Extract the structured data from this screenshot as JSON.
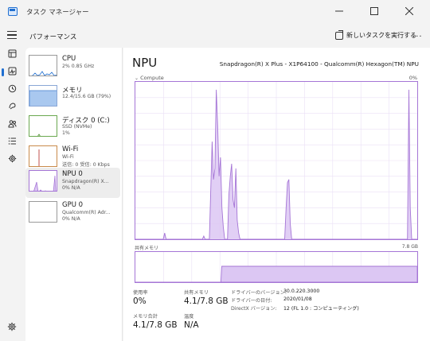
{
  "window": {
    "title": "タスク マネージャー",
    "minimize_icon": "minimize-icon",
    "maximize_icon": "maximize-icon",
    "close_icon": "close-icon"
  },
  "header": {
    "page_title": "パフォーマンス",
    "new_task_label": "新しいタスクを実行する",
    "more_label": "..."
  },
  "nav": [
    {
      "name": "processes",
      "icon": "processes-icon"
    },
    {
      "name": "performance",
      "icon": "performance-icon",
      "active": true
    },
    {
      "name": "app-history",
      "icon": "history-icon"
    },
    {
      "name": "startup-apps",
      "icon": "startup-icon"
    },
    {
      "name": "users",
      "icon": "users-icon"
    },
    {
      "name": "details",
      "icon": "details-icon"
    },
    {
      "name": "services",
      "icon": "services-icon"
    },
    {
      "name": "settings",
      "icon": "gear-icon"
    }
  ],
  "resources": [
    {
      "name": "CPU",
      "line1": "2% 0.85 GHz",
      "line2": ""
    },
    {
      "name": "メモリ",
      "line1": "12.4/15.6 GB (79%)",
      "line2": ""
    },
    {
      "name": "ディスク 0 (C:)",
      "line1": "SSD (NVMe)",
      "line2": "1%"
    },
    {
      "name": "Wi-Fi",
      "line1": "Wi-Fi",
      "line2": "送信: 0 受信: 0 Kbps"
    },
    {
      "name": "NPU 0",
      "line1": "Snapdragon(R) X...",
      "line2": "0% N/A"
    },
    {
      "name": "GPU 0",
      "line1": "Qualcomm(R) Adr...",
      "line2": "0% N/A"
    }
  ],
  "detail": {
    "title": "NPU",
    "model": "Snapdragon(R) X Plus - X1P64100 - Qualcomm(R) Hexagon(TM) NPU",
    "graph_label": "Compute",
    "graph_pct": "0%",
    "mem_label": "共有メモリ",
    "mem_max": "7.8 GB",
    "stats": {
      "usage_label": "使用率",
      "usage_value": "0%",
      "shared_label": "共有メモリ",
      "shared_value": "4.1/7.8 GB",
      "memtotal_label": "メモリ合計",
      "memtotal_value": "4.1/7.8 GB",
      "temp_label": "温度",
      "temp_value": "N/A"
    },
    "info": [
      {
        "label": "ドライバーのバージョン:",
        "value": "30.0.220.3000"
      },
      {
        "label": "ドライバーの日付:",
        "value": "2020/01/08"
      },
      {
        "label": "DirectX バージョン:",
        "value": "12 (FL 1.0 : コンピューティング)"
      }
    ]
  },
  "colors": {
    "accent": "#1f6fd1",
    "npu_line": "#a575d6",
    "npu_fill": "#dcc7f3"
  },
  "npu_graph": {
    "usage_percent": [
      0,
      0,
      0,
      0,
      0,
      0,
      0,
      0,
      0,
      0,
      0,
      0,
      0,
      0,
      0,
      0,
      0,
      0,
      0,
      0,
      0,
      4,
      0,
      0,
      0,
      0,
      0,
      0,
      0,
      0,
      0,
      0,
      0,
      0,
      0,
      0,
      0,
      0,
      0,
      0,
      0,
      0,
      0,
      0,
      0,
      0,
      0,
      0,
      0,
      2,
      0,
      0,
      0,
      0,
      30,
      62,
      38,
      45,
      95,
      72,
      40,
      52,
      20,
      8,
      0,
      0,
      0,
      28,
      40,
      48,
      25,
      20,
      45,
      12,
      4,
      0,
      0,
      0,
      0,
      0,
      0,
      0,
      0,
      0,
      0,
      0,
      0,
      0,
      0,
      0,
      0,
      0,
      0,
      0,
      0,
      0,
      0,
      0,
      0,
      0,
      0,
      0,
      0,
      0,
      0,
      0,
      0,
      0,
      20,
      36,
      38,
      10,
      0,
      0,
      0,
      0,
      0,
      0,
      0,
      0,
      0,
      0,
      0,
      0,
      0,
      0,
      0,
      0,
      0,
      0,
      0,
      0,
      0,
      0,
      0,
      0,
      0,
      0,
      0,
      0,
      0,
      0,
      0,
      0,
      0,
      0,
      0,
      0,
      0,
      0,
      0,
      0,
      0,
      0,
      0,
      0,
      0,
      0,
      0,
      0,
      0,
      0,
      0,
      0,
      0,
      0,
      0,
      0,
      0,
      0,
      0,
      0,
      0,
      0,
      0,
      0,
      0,
      0,
      0,
      0,
      0,
      0,
      0,
      0,
      0,
      0,
      0,
      0,
      0,
      0,
      0,
      0,
      0,
      0,
      0,
      0,
      95,
      20,
      0,
      0,
      0,
      0,
      0
    ],
    "shared_memory_gb": [
      0,
      0,
      0,
      0,
      0,
      0,
      0,
      0,
      0,
      0,
      0,
      0,
      0,
      0,
      0,
      0,
      0,
      0,
      0,
      0,
      0,
      0,
      0,
      0,
      0,
      0,
      0,
      0,
      0,
      0,
      0,
      0,
      0,
      0,
      0,
      0,
      0,
      0,
      0,
      0,
      0,
      0,
      0,
      0,
      0,
      0,
      0,
      0,
      0,
      0,
      0,
      0,
      0,
      0,
      0,
      0,
      0,
      0,
      0,
      0,
      0,
      0,
      0,
      0,
      0,
      0,
      0,
      0,
      0,
      0,
      0,
      0,
      0,
      0,
      0,
      0,
      0,
      0,
      0,
      0,
      0,
      0,
      0,
      0,
      0,
      0,
      0,
      0,
      0,
      0,
      0,
      0,
      0,
      0,
      0,
      0,
      0,
      0,
      0,
      4.1,
      4.1,
      4.1,
      4.1,
      4.1,
      4.1,
      4.1,
      4.1,
      4.1,
      4.1,
      4.1,
      4.1,
      4.1,
      4.1,
      4.1,
      4.1,
      4.1,
      4.1,
      4.1,
      4.1,
      4.1,
      4.1,
      4.1,
      4.1,
      4.1,
      4.1,
      4.1,
      4.1,
      4.1,
      4.1,
      4.1,
      4.1,
      4.1,
      4.1,
      4.1,
      4.1,
      4.1,
      4.1,
      4.1,
      4.1,
      4.1,
      4.1,
      4.1,
      4.1,
      4.1,
      4.1,
      4.1,
      4.1,
      4.1,
      4.1,
      4.1,
      4.1,
      4.1,
      4.1,
      4.1,
      4.1,
      4.1,
      4.1,
      4.1,
      4.1,
      4.1,
      4.1,
      4.1,
      4.1,
      4.1,
      4.1,
      4.1,
      4.1,
      4.1,
      4.1,
      4.1,
      4.1,
      4.1,
      4.1,
      4.1,
      4.1,
      4.1,
      4.1,
      4.1,
      4.1,
      4.1,
      4.1,
      4.1,
      4.1,
      4.1,
      4.1,
      4.1,
      4.1,
      4.1,
      4.1,
      4.1,
      4.1,
      4.1,
      4.1,
      4.1,
      4.1,
      4.1,
      4.1,
      4.1,
      4.1,
      4.1,
      4.1,
      4.1,
      4.1,
      4.1,
      4.1,
      4.1,
      4.1,
      4.1,
      4.1,
      4.1,
      4.1,
      4.1,
      4.1,
      4.1,
      4.1,
      4.1,
      4.1,
      4.1,
      4.1,
      4.1,
      4.1,
      4.1,
      4.1,
      4.1,
      4.1,
      4.1,
      4.1,
      4.1,
      4.1,
      4.1,
      4.1,
      4.1,
      4.1,
      4.1,
      4.1,
      4.1,
      4.1,
      4.1,
      4.1,
      4.1,
      4.1,
      4.1,
      4.1,
      4.1,
      4.1,
      4.1,
      4.1,
      4.1,
      4.1,
      4.1,
      4.1,
      4.1,
      4.1,
      4.1,
      4.1,
      4.1,
      4.1,
      4.1,
      4.1,
      4.1,
      4.1,
      4.1,
      4.1,
      4.1,
      4.1,
      4.1,
      4.1,
      4.1,
      4.1,
      4.1,
      4.1,
      4.1,
      4.1,
      4.1,
      4.1,
      4.1,
      4.1,
      4.1,
      4.1,
      4.1,
      4.1,
      4.1,
      4.1,
      4.1,
      4.1,
      4.1,
      4.1,
      4.1,
      4.1,
      4.1,
      4.1,
      4.1,
      4.1,
      4.1,
      4.1,
      4.1,
      4.1,
      4.1,
      4.1,
      4.1,
      4.1,
      4.1,
      4.1,
      4.1,
      4.1,
      4.1,
      4.1,
      4.1,
      4.1,
      4.1,
      4.1,
      4.1,
      4.1,
      4.1,
      4.1,
      4.1,
      4.1,
      4.1,
      4.1,
      4.1,
      4.1,
      4.1,
      4.1,
      4.1
    ],
    "shared_memory_max_gb": 7.8
  }
}
